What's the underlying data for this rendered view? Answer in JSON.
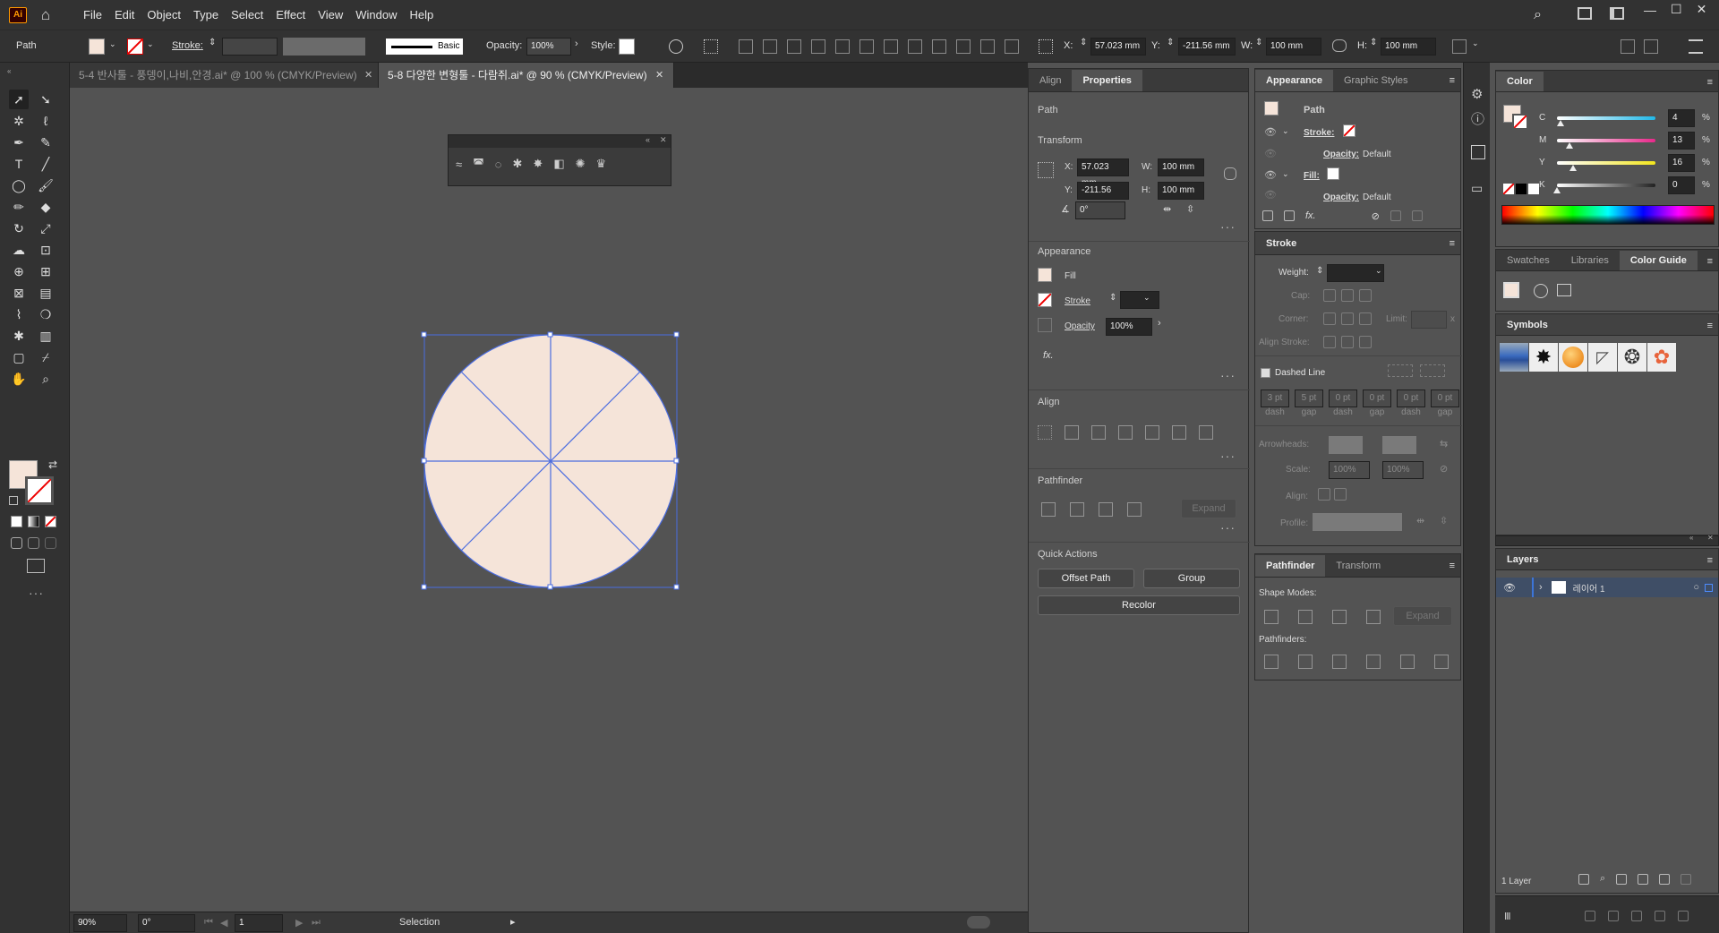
{
  "app": {
    "logo": "Ai"
  },
  "menu": [
    "File",
    "Edit",
    "Object",
    "Type",
    "Select",
    "Effect",
    "View",
    "Window",
    "Help"
  ],
  "control": {
    "path_label": "Path",
    "stroke_label": "Stroke:",
    "brush": "Basic",
    "opacity_label": "Opacity:",
    "opacity_value": "100%",
    "style_label": "Style:",
    "x_label": "X:",
    "x_value": "57.023 mm",
    "y_label": "Y:",
    "y_value": "-211.56 mm",
    "w_label": "W:",
    "w_value": "100 mm",
    "h_label": "H:",
    "h_value": "100 mm"
  },
  "tabs": [
    {
      "label": "5-4 반사툴 - 풍뎅이,나비,안경.ai* @ 100 % (CMYK/Preview)",
      "active": false
    },
    {
      "label": "5-8 다양한 변형툴 - 다람쥐.ai* @ 90 % (CMYK/Preview)",
      "active": true
    }
  ],
  "status": {
    "zoom": "90%",
    "rotate": "0°",
    "artboard": "1",
    "tool": "Selection"
  },
  "colors": {
    "fill": "#f5e4d9",
    "selection": "#4a6ce0",
    "accent": "#2b7bde"
  },
  "properties": {
    "tabs": [
      "Align",
      "Properties"
    ],
    "path": "Path",
    "transform": {
      "title": "Transform",
      "x_label": "X:",
      "x": "57.023 mm",
      "y_label": "Y:",
      "y": "-211.56 mm",
      "w_label": "W:",
      "w": "100 mm",
      "h_label": "H:",
      "h": "100 mm",
      "angle": "0°"
    },
    "appearance": {
      "title": "Appearance",
      "fill": "Fill",
      "stroke": "Stroke",
      "opacity": "Opacity",
      "opacity_value": "100%",
      "fx": "fx."
    },
    "align_title": "Align",
    "pathfinder": {
      "title": "Pathfinder",
      "expand": "Expand"
    },
    "quick_actions": {
      "title": "Quick Actions",
      "offset_path": "Offset Path",
      "group": "Group",
      "recolor": "Recolor"
    }
  },
  "appearance_panel": {
    "tabs": [
      "Appearance",
      "Graphic Styles"
    ],
    "path": "Path",
    "stroke": "Stroke:",
    "opacity1_label": "Opacity:",
    "opacity1_value": "Default",
    "fill": "Fill:",
    "opacity2_label": "Opacity:",
    "opacity2_value": "Default",
    "fx": "fx."
  },
  "stroke_panel": {
    "title": "Stroke",
    "weight": "Weight:",
    "cap": "Cap:",
    "corner": "Corner:",
    "limit": "Limit:",
    "x": "x",
    "align_stroke": "Align Stroke:",
    "dashed": "Dashed Line",
    "dash_values": [
      "3 pt",
      "5 pt",
      "0 pt",
      "0 pt",
      "0 pt",
      "0 pt"
    ],
    "dash_labels": [
      "dash",
      "gap",
      "dash",
      "gap",
      "dash",
      "gap"
    ],
    "arrowheads": "Arrowheads:",
    "scale": "Scale:",
    "scale1": "100%",
    "scale2": "100%",
    "align": "Align:",
    "profile": "Profile:"
  },
  "pathfinder_panel": {
    "tabs": [
      "Pathfinder",
      "Transform"
    ],
    "shape_modes": "Shape Modes:",
    "expand": "Expand",
    "pathfinders": "Pathfinders:"
  },
  "color_panel": {
    "title": "Color",
    "channels": [
      {
        "label": "C",
        "value": "4",
        "color": "#21b8e8"
      },
      {
        "label": "M",
        "value": "13",
        "color": "#e8288a"
      },
      {
        "label": "Y",
        "value": "16",
        "color": "#f2e51d"
      },
      {
        "label": "K",
        "value": "0",
        "color": "#222222"
      }
    ],
    "pct": "%"
  },
  "swatch_tabs": [
    "Swatches",
    "Libraries",
    "Color Guide"
  ],
  "symbols": {
    "title": "Symbols"
  },
  "layers": {
    "title": "Layers",
    "layer_name": "레이어 1",
    "count": "1 Layer"
  }
}
